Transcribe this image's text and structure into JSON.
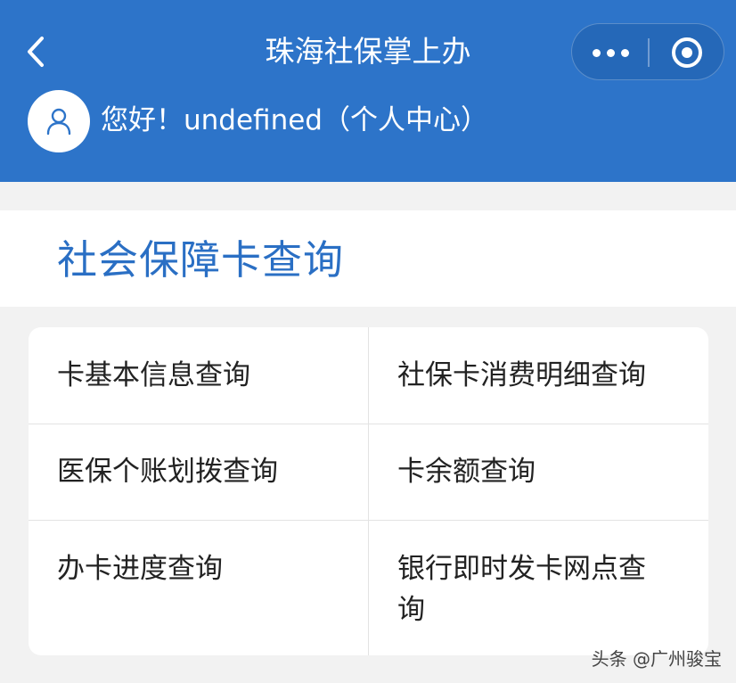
{
  "header": {
    "title": "珠海社保掌上办",
    "greeting": "您好！undefined（个人中心）",
    "back_icon": "chevron-left-icon",
    "more_icon": "more-dots-icon",
    "close_icon": "target-circle-icon",
    "avatar_icon": "user-icon",
    "background_color": "#2d74c9"
  },
  "section": {
    "title": "社会保障卡查询",
    "title_color": "#2a6fc4"
  },
  "menu": [
    {
      "label": "卡基本信息查询"
    },
    {
      "label": "社保卡消费明细查询"
    },
    {
      "label": "医保个账划拨查询"
    },
    {
      "label": "卡余额查询"
    },
    {
      "label": "办卡进度查询"
    },
    {
      "label": "银行即时发卡网点查询"
    }
  ],
  "watermark": "头条 @广州骏宝"
}
